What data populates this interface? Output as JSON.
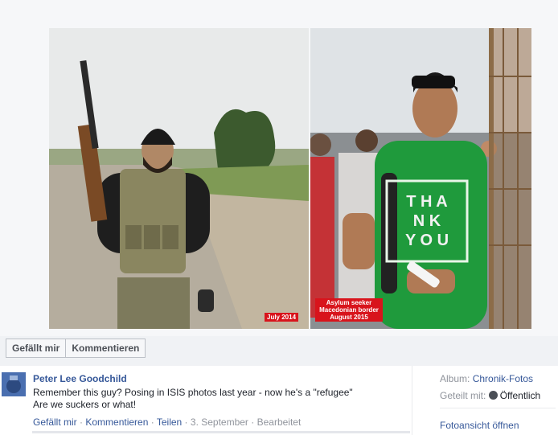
{
  "photo": {
    "left_caption": "July 2014",
    "right_caption_lines": [
      "Asylum seeker",
      "Macedonian border",
      "August 2015"
    ],
    "shirt_text": [
      "T H A",
      "N K",
      "Y O U"
    ]
  },
  "buttons": {
    "like": "Gefällt mir",
    "comment": "Kommentieren"
  },
  "post": {
    "author": "Peter Lee Goodchild",
    "line1": "Remember this guy? Posing in ISIS photos last year - now he's a \"refugee\"",
    "line2": "Are we suckers or what!",
    "actions": {
      "like": "Gefällt mir",
      "comment": "Kommentieren",
      "share": "Teilen",
      "date": "3. September",
      "edited": "Bearbeitet",
      "sep": " · "
    }
  },
  "side": {
    "album_label": "Album:",
    "album_value": "Chronik-Fotos",
    "shared_label": "Geteilt mit:",
    "shared_value": "Öffentlich",
    "open_link": "Fotoansicht öffnen"
  },
  "colors": {
    "link": "#365899",
    "caption_red": "#d8141c",
    "shirt_green": "#1f9a3c"
  }
}
